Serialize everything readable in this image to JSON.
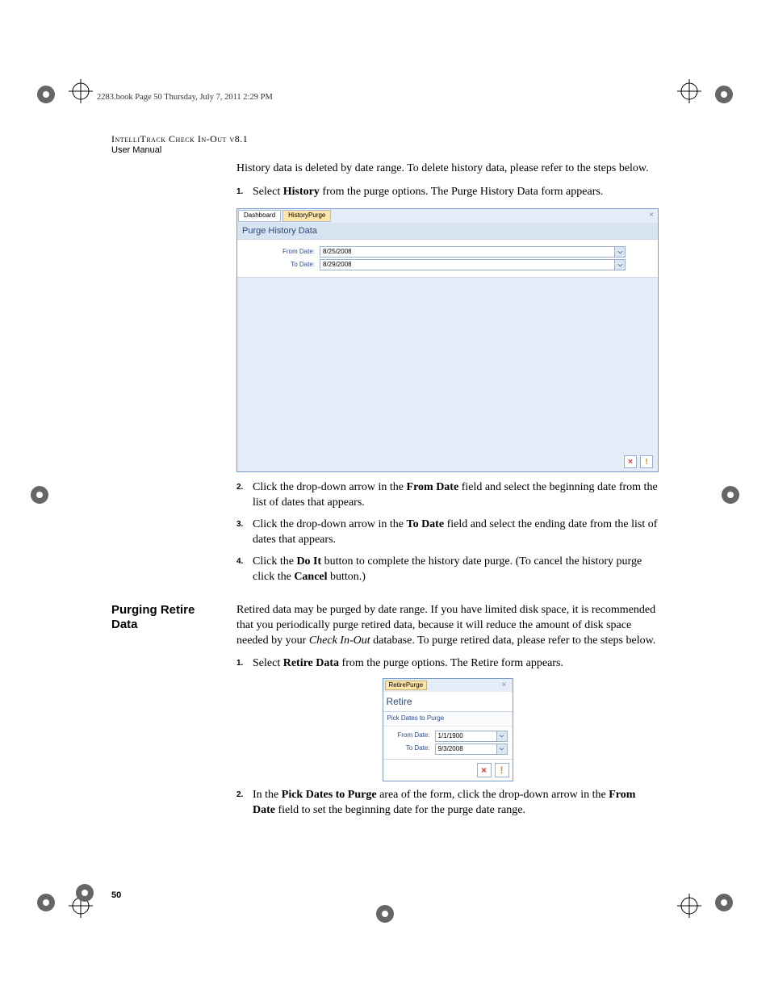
{
  "header_line": "2283.book  Page 50  Thursday, July 7, 2011  2:29 PM",
  "doc": {
    "title": "IntelliTrack Check In-Out v8.1",
    "sub": "User Manual"
  },
  "intro": "History data is deleted by date range. To delete history data, please refer to the steps below.",
  "steps_a": {
    "n1": "1.",
    "t1a": "Select ",
    "t1b": "History",
    "t1c": " from the purge options. The Purge History Data form appears.",
    "n2": "2.",
    "t2a": "Click the drop-down arrow in the ",
    "t2b": "From Date",
    "t2c": " field and select the beginning date from the list of dates that appears.",
    "n3": "3.",
    "t3a": "Click the drop-down arrow in the ",
    "t3b": "To Date",
    "t3c": " field and select the ending date from the list of dates that appears.",
    "n4": "4.",
    "t4a": "Click the ",
    "t4b": "Do It",
    "t4c": " button to complete the history date purge. (To cancel the history purge click the ",
    "t4d": "Cancel",
    "t4e": " button.)"
  },
  "fig1": {
    "tab1": "Dashboard",
    "tab2": "HistoryPurge",
    "close": "×",
    "title": "Purge History Data",
    "from_label": "From Date:",
    "from_value": "8/25/2008",
    "to_label": "To Date:",
    "to_value": "8/29/2008",
    "btn_x": "×",
    "btn_bang": "!"
  },
  "sectionB": {
    "heading": "Purging Retire Data",
    "para_a": "Retired data may be purged by date range. If you have limited disk space, it is recommended that you periodically purge retired data, because it will reduce the amount of disk space needed by your ",
    "para_b": "Check In-Out",
    "para_c": " database. To purge retired data, please refer to the steps below.",
    "n1": "1.",
    "t1a": "Select ",
    "t1b": "Retire Data",
    "t1c": " from the purge options. The Retire form appears.",
    "n2": "2.",
    "t2a": "In the ",
    "t2b": "Pick Dates to Purge",
    "t2c": " area of the form, click the drop-down arrow in the ",
    "t2d": "From Date",
    "t2e": " field to set the beginning date for the purge date range."
  },
  "fig2": {
    "tab": "RetirePurge",
    "close": "×",
    "title": "Retire",
    "section": "Pick Dates to Purge",
    "from_label": "From Date:",
    "from_value": "1/1/1900",
    "to_label": "To Date:",
    "to_value": "9/3/2008",
    "btn_x": "×",
    "btn_bang": "!"
  },
  "page_num": "50"
}
